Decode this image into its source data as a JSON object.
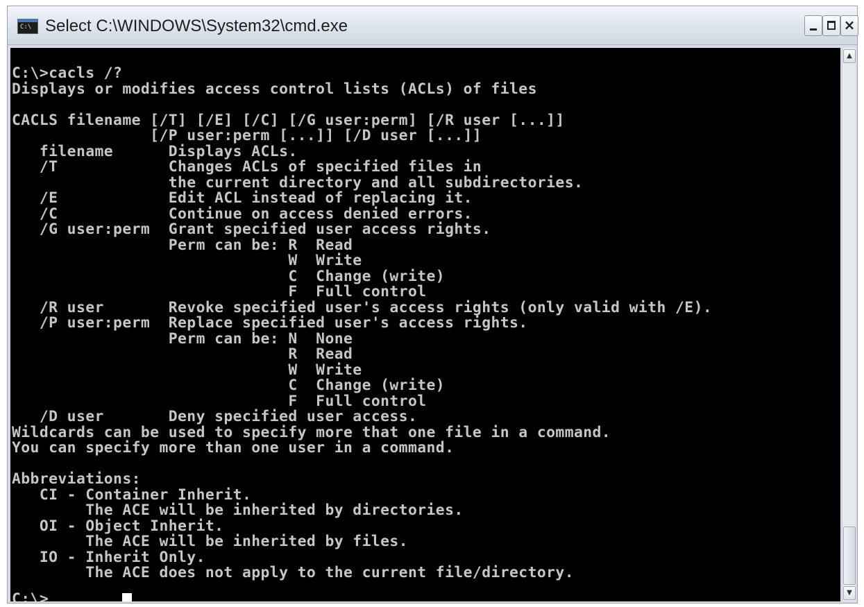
{
  "window": {
    "title": "Select C:\\WINDOWS\\System32\\cmd.exe",
    "icon_label": "C:\\",
    "controls": {
      "minimize": "minimize",
      "maximize": "maximize",
      "close": "×"
    }
  },
  "console": {
    "output": "C:\\>cacls /?\nDisplays or modifies access control lists (ACLs) of files\n\nCACLS filename [/T] [/E] [/C] [/G user:perm] [/R user [...]]\n               [/P user:perm [...]] [/D user [...]]\n   filename      Displays ACLs.\n   /T            Changes ACLs of specified files in\n                 the current directory and all subdirectories.\n   /E            Edit ACL instead of replacing it.\n   /C            Continue on access denied errors.\n   /G user:perm  Grant specified user access rights.\n                 Perm can be: R  Read\n                              W  Write\n                              C  Change (write)\n                              F  Full control\n   /R user       Revoke specified user's access rights (only valid with /E).\n   /P user:perm  Replace specified user's access rights.\n                 Perm can be: N  None\n                              R  Read\n                              W  Write\n                              C  Change (write)\n                              F  Full control\n   /D user       Deny specified user access.\nWildcards can be used to specify more that one file in a command.\nYou can specify more than one user in a command.\n\nAbbreviations:\n   CI - Container Inherit.\n        The ACE will be inherited by directories.\n   OI - Object Inherit.\n        The ACE will be inherited by files.\n   IO - Inherit Only.\n        The ACE does not apply to the current file/directory.",
    "prompt": "C:\\>"
  },
  "scrollbar": {
    "up_arrow": "▲",
    "down_arrow": "▼"
  },
  "colors": {
    "console_background": "#000000",
    "console_text": "#c6c6c6",
    "titlebar": "#dde4ec"
  }
}
